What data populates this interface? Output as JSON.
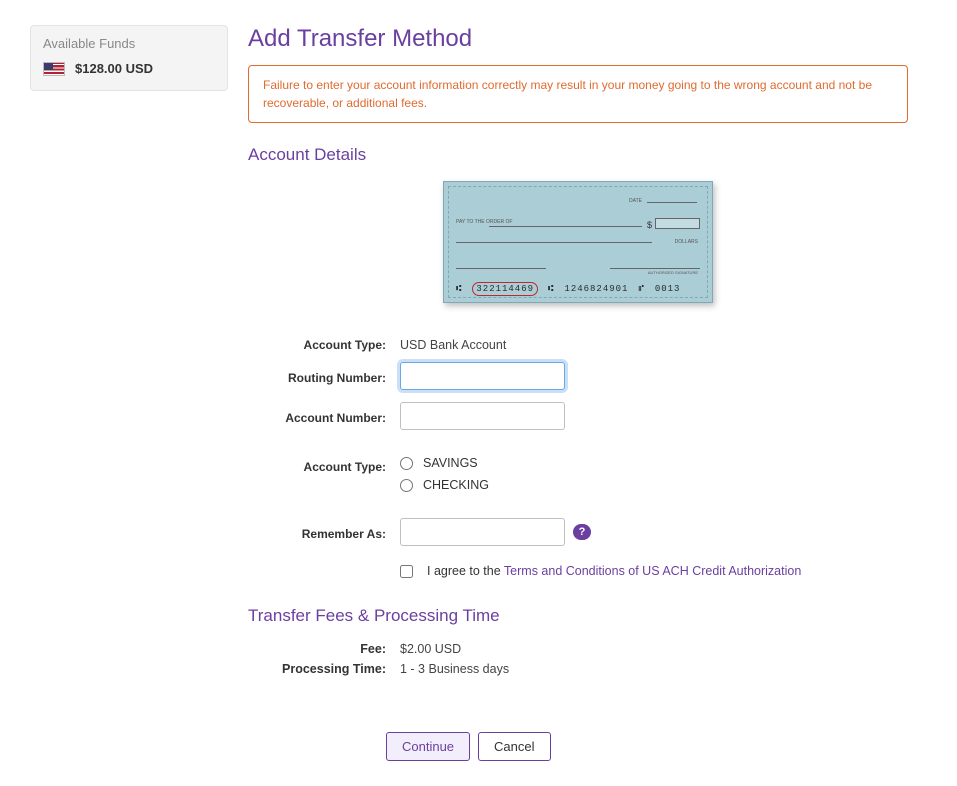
{
  "sidebar": {
    "funds_title": "Available Funds",
    "funds_amount": "$128.00 USD"
  },
  "page": {
    "title": "Add Transfer Method",
    "alert": "Failure to enter your account information correctly may result in your money going to the wrong account and not be recoverable, or additional fees.",
    "section_account_details": "Account Details",
    "section_fees": "Transfer Fees & Processing Time"
  },
  "check": {
    "date_label": "DATE",
    "payto": "PAY TO THE\nORDER OF",
    "dollars_label": "DOLLARS",
    "sig_label": "AUTHORIZED SIGNATURE",
    "routing": "322114469",
    "account": "1246824901",
    "checknum": "0013"
  },
  "form": {
    "labels": {
      "account_type": "Account Type:",
      "routing_number": "Routing Number:",
      "account_number": "Account Number:",
      "account_type2": "Account Type:",
      "remember_as": "Remember As:"
    },
    "values": {
      "account_type": "USD Bank Account",
      "routing_number": "",
      "account_number": "",
      "remember_as": ""
    },
    "options": {
      "savings": "SAVINGS",
      "checking": "CHECKING"
    },
    "agree_prefix": "I agree to the ",
    "agree_link": "Terms and Conditions of US ACH Credit Authorization",
    "help_glyph": "?"
  },
  "fees": {
    "fee_label": "Fee:",
    "fee_value": "$2.00 USD",
    "processing_label": "Processing Time:",
    "processing_value": "1 - 3 Business days"
  },
  "buttons": {
    "continue": "Continue",
    "cancel": "Cancel"
  }
}
